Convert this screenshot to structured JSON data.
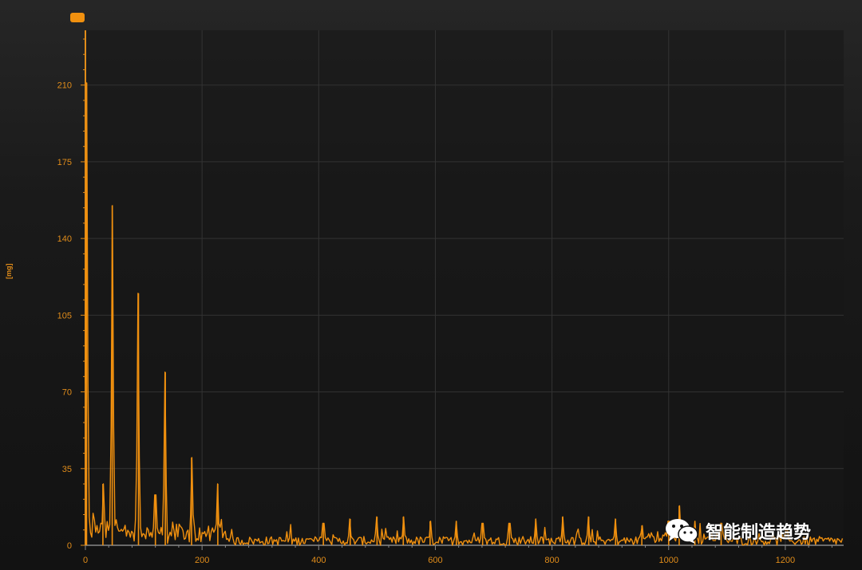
{
  "watermark": {
    "text": "智能制造趋势",
    "icon": "wechat-logo"
  },
  "colors": {
    "series": "#f0900f",
    "axis": "#e08c1a",
    "grid": "#333333",
    "background": "#121212"
  },
  "chart_data": {
    "type": "line",
    "title": "",
    "xlabel": "",
    "ylabel": "[mg]",
    "xlim": [
      0,
      1300
    ],
    "ylim": [
      0,
      235
    ],
    "xticks": [
      0,
      200,
      400,
      600,
      800,
      1000,
      1200
    ],
    "yticks": [
      0,
      35,
      70,
      105,
      140,
      175,
      210
    ],
    "grid": true,
    "legend": "top-left",
    "series": [
      {
        "name": "",
        "peaks": [
          {
            "x": 2,
            "y": 211
          },
          {
            "x": 46,
            "y": 155
          },
          {
            "x": 91,
            "y": 115
          },
          {
            "x": 137,
            "y": 79
          },
          {
            "x": 182,
            "y": 40
          },
          {
            "x": 227,
            "y": 28
          },
          {
            "x": 30,
            "y": 28
          },
          {
            "x": 120,
            "y": 23
          },
          {
            "x": 408,
            "y": 10
          },
          {
            "x": 454,
            "y": 12
          },
          {
            "x": 500,
            "y": 13
          },
          {
            "x": 545,
            "y": 13
          },
          {
            "x": 591,
            "y": 11
          },
          {
            "x": 636,
            "y": 11
          },
          {
            "x": 681,
            "y": 10
          },
          {
            "x": 727,
            "y": 10
          },
          {
            "x": 772,
            "y": 12
          },
          {
            "x": 818,
            "y": 13
          },
          {
            "x": 863,
            "y": 13
          },
          {
            "x": 909,
            "y": 12
          },
          {
            "x": 954,
            "y": 9
          },
          {
            "x": 1000,
            "y": 11
          },
          {
            "x": 1018,
            "y": 18
          },
          {
            "x": 1045,
            "y": 11
          },
          {
            "x": 1090,
            "y": 10
          }
        ],
        "noise_floor": 4
      }
    ]
  }
}
